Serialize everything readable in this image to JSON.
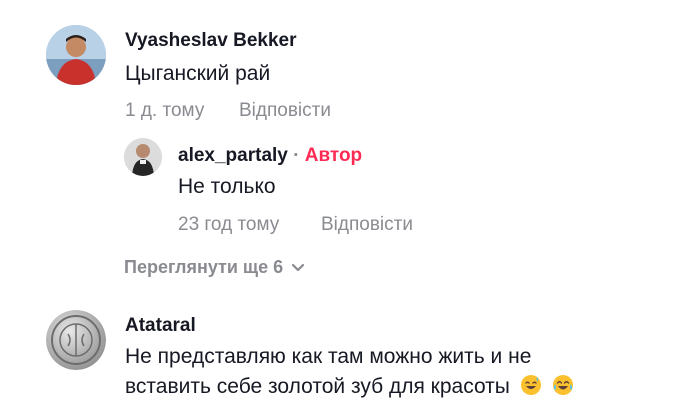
{
  "comments": [
    {
      "author": "Vyasheslav Bekker",
      "text": "Цыганский рай",
      "time": "1 д. тому",
      "reply_label": "Відповісти",
      "replies": [
        {
          "author": "alex_partaly",
          "separator": "·",
          "badge": "Автор",
          "text": "Не только",
          "time": "23 год тому",
          "reply_label": "Відповісти"
        }
      ],
      "view_more_label": "Переглянути ще 6"
    },
    {
      "author": "Atataral",
      "text_line1": "Не представляю как там можно жить и не",
      "text_line2": "вставить себе золотой зуб для красоты",
      "emojis": [
        "sweat-smile-emoji",
        "joy-emoji"
      ]
    }
  ],
  "colors": {
    "text": "#161823",
    "muted": "#8a8b91",
    "author_badge": "#fe2c55"
  }
}
